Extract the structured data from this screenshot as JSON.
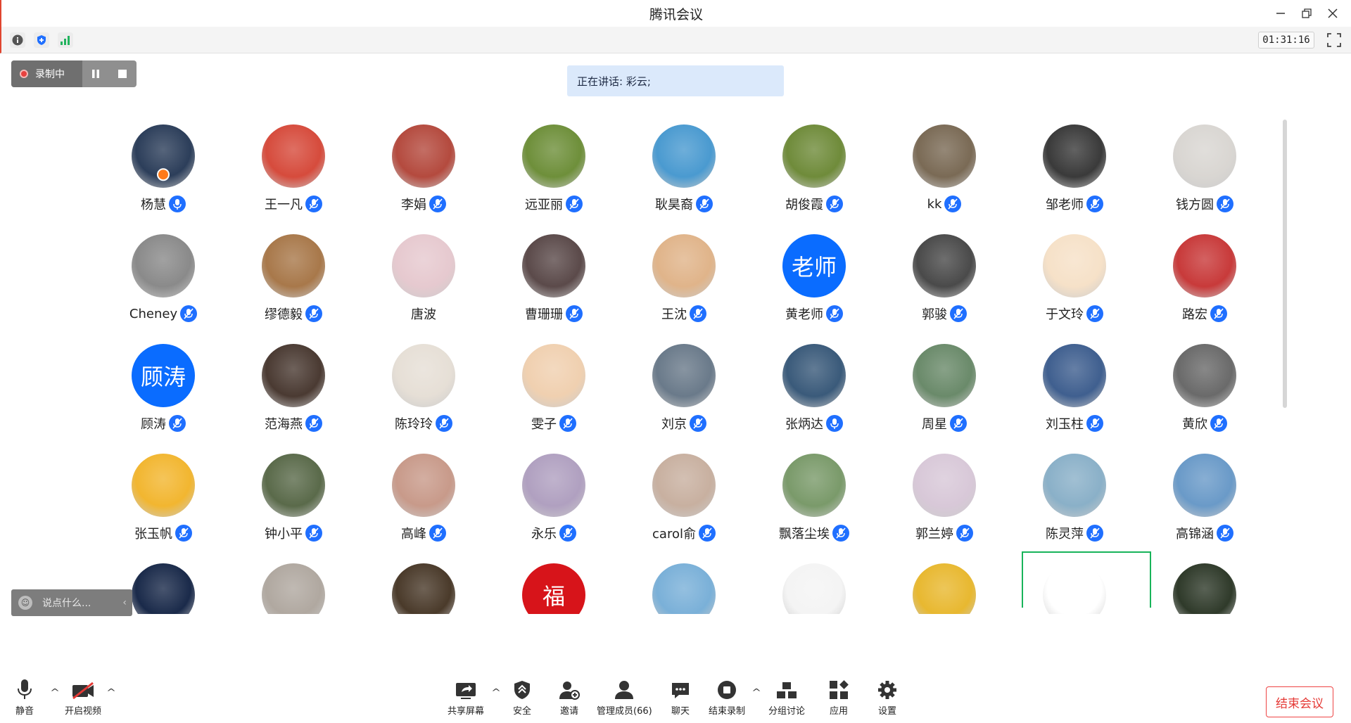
{
  "window": {
    "title": "腾讯会议"
  },
  "info": {
    "timer": "01:31:16"
  },
  "recording": {
    "label": "录制中"
  },
  "speaking": {
    "text": "正在讲话: 彩云;"
  },
  "participants": [
    {
      "name": "杨慧",
      "host": true,
      "mic": "active"
    },
    {
      "name": "王一凡",
      "mic": "muted"
    },
    {
      "name": "李娟",
      "mic": "muted"
    },
    {
      "name": "远亚丽",
      "mic": "muted"
    },
    {
      "name": "耿昊裔",
      "mic": "muted"
    },
    {
      "name": "胡俊霞",
      "mic": "muted"
    },
    {
      "name": "kk",
      "mic": "muted"
    },
    {
      "name": "邹老师",
      "mic": "muted"
    },
    {
      "name": "钱方圆",
      "mic": "muted"
    },
    {
      "name": "Cheney",
      "mic": "muted"
    },
    {
      "name": "缪德毅",
      "mic": "muted"
    },
    {
      "name": "唐波",
      "mic": "none"
    },
    {
      "name": "曹珊珊",
      "mic": "muted"
    },
    {
      "name": "王沈",
      "mic": "muted"
    },
    {
      "name": "黄老师",
      "mic": "muted",
      "avatar_text": "老师",
      "avatar_color": "#0a6cff"
    },
    {
      "name": "郭骏",
      "mic": "muted"
    },
    {
      "name": "于文玲",
      "mic": "muted"
    },
    {
      "name": "路宏",
      "mic": "muted"
    },
    {
      "name": "顾涛",
      "mic": "muted",
      "avatar_text": "顾涛",
      "avatar_color": "#0a6cff"
    },
    {
      "name": "范海燕",
      "mic": "muted"
    },
    {
      "name": "陈玲玲",
      "mic": "muted"
    },
    {
      "name": "雯子",
      "mic": "muted"
    },
    {
      "name": "刘京",
      "mic": "muted"
    },
    {
      "name": "张炳达",
      "mic": "active"
    },
    {
      "name": "周星",
      "mic": "muted"
    },
    {
      "name": "刘玉柱",
      "mic": "muted"
    },
    {
      "name": "黄欣",
      "mic": "muted"
    },
    {
      "name": "张玉帆",
      "mic": "muted"
    },
    {
      "name": "钟小平",
      "mic": "muted"
    },
    {
      "name": "高峰",
      "mic": "muted"
    },
    {
      "name": "永乐",
      "mic": "muted"
    },
    {
      "name": "carol俞",
      "mic": "muted"
    },
    {
      "name": "飘落尘埃",
      "mic": "muted"
    },
    {
      "name": "郭兰婷",
      "mic": "muted"
    },
    {
      "name": "陈灵萍",
      "mic": "muted"
    },
    {
      "name": "高锦涵",
      "mic": "muted"
    },
    {
      "name": "",
      "mic": "none"
    },
    {
      "name": "",
      "mic": "none"
    },
    {
      "name": "",
      "mic": "none"
    },
    {
      "name": "",
      "mic": "none",
      "avatar_text": "福",
      "avatar_color": "#d7141a"
    },
    {
      "name": "",
      "mic": "none"
    },
    {
      "name": "",
      "mic": "none"
    },
    {
      "name": "",
      "mic": "none"
    },
    {
      "name": "",
      "mic": "none",
      "active": true
    },
    {
      "name": "",
      "mic": "none"
    }
  ],
  "avatar_colors": [
    "#2c3e5a",
    "#d64b3c",
    "#b44a3e",
    "#6e8f3a",
    "#4a9ad0",
    "#6f8b3a",
    "#7a6a55",
    "#3a3a3a",
    "#d9d6d2",
    "#8a8a8a",
    "#a8784a",
    "#e6c9cf",
    "#5b4a4a",
    "#e0b48a",
    "#0a6cff",
    "#4a4a4a",
    "#f6e1c8",
    "#c83a3a",
    "#0a6cff",
    "#4a3a32",
    "#e6dfd6",
    "#f0d0b0",
    "#6a7a8a",
    "#3a5a7a",
    "#6a8a6a",
    "#3f5f8f",
    "#6a6a6a",
    "#f2b630",
    "#5a6a4a",
    "#c89a8a",
    "#b0a0c0",
    "#c8b0a0",
    "#7a9a6a",
    "#d8c8d8",
    "#8ab0c8",
    "#6a9ac8",
    "#1a2a4a",
    "#b0a8a0",
    "#4a3a2a",
    "#d7141a",
    "#7ab0d8",
    "#f4f4f4",
    "#e8b830",
    "#ffffff",
    "#2f3a2a"
  ],
  "chat": {
    "placeholder": "说点什么..."
  },
  "toolbar": {
    "mute": "静音",
    "video": "开启视频",
    "share": "共享屏幕",
    "security": "安全",
    "invite": "邀请",
    "members": "管理成员(66)",
    "chat": "聊天",
    "end_record": "结束录制",
    "breakout": "分组讨论",
    "apps": "应用",
    "settings": "设置",
    "end_meeting": "结束会议"
  }
}
